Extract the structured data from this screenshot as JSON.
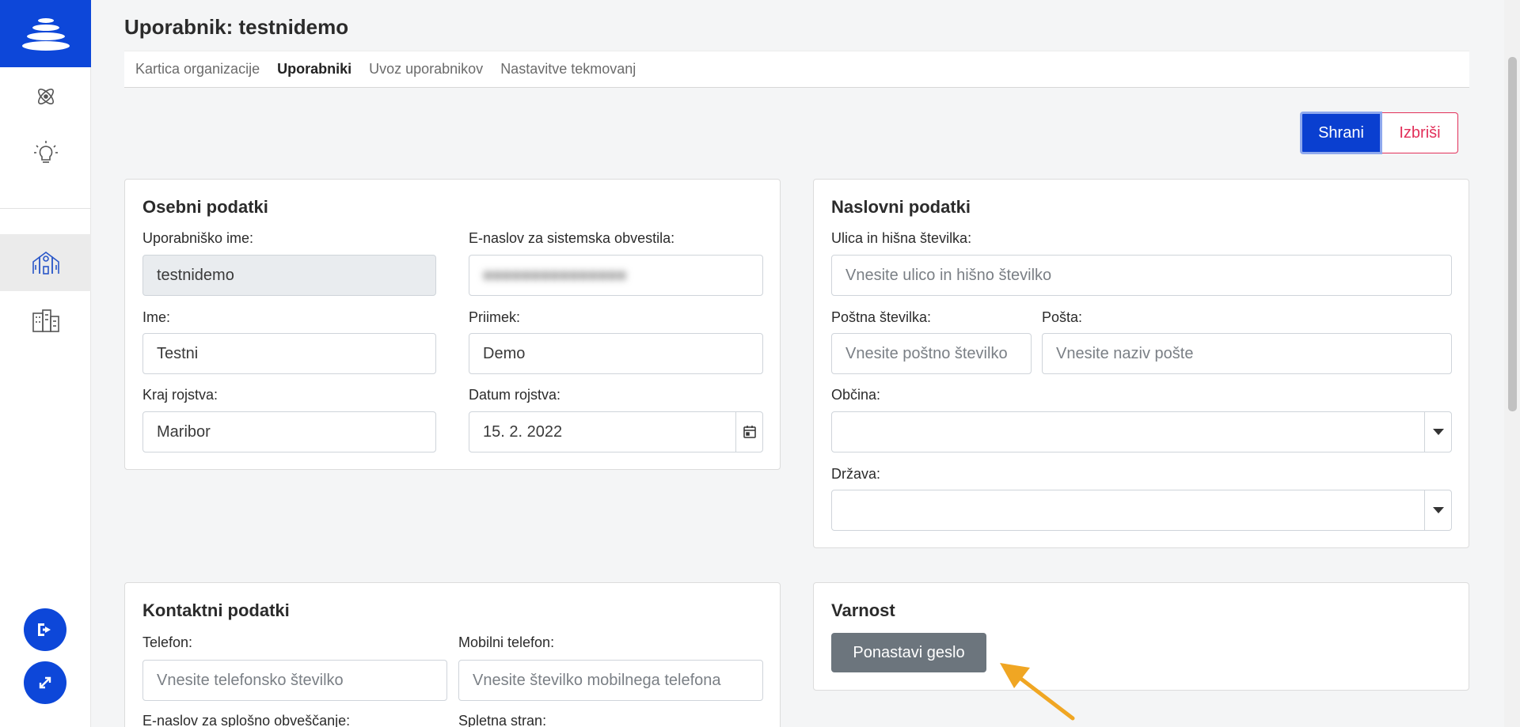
{
  "page_title": "Uporabnik: testnidemo",
  "subnav": [
    {
      "label": "Kartica organizacije",
      "active": false
    },
    {
      "label": "Uporabniki",
      "active": true
    },
    {
      "label": "Uvoz uporabnikov",
      "active": false
    },
    {
      "label": "Nastavitve tekmovanj",
      "active": false
    }
  ],
  "actions": {
    "save_label": "Shrani",
    "delete_label": "Izbriši"
  },
  "personal": {
    "title": "Osebni podatki",
    "username_label": "Uporabniško ime:",
    "username_value": "testnidemo",
    "email_label": "E-naslov za sistemska obvestila:",
    "firstname_label": "Ime:",
    "firstname_value": "Testni",
    "lastname_label": "Priimek:",
    "lastname_value": "Demo",
    "birthplace_label": "Kraj rojstva:",
    "birthplace_value": "Maribor",
    "birthdate_label": "Datum rojstva:",
    "birthdate_value": "15. 2. 2022"
  },
  "address": {
    "title": "Naslovni podatki",
    "street_label": "Ulica in hišna številka:",
    "street_placeholder": "Vnesite ulico in hišno številko",
    "postcode_label": "Poštna številka:",
    "postcode_placeholder": "Vnesite poštno številko",
    "post_label": "Pošta:",
    "post_placeholder": "Vnesite naziv pošte",
    "municipality_label": "Občina:",
    "country_label": "Država:"
  },
  "contact": {
    "title": "Kontaktni podatki",
    "phone_label": "Telefon:",
    "phone_placeholder": "Vnesite telefonsko številko",
    "mobile_label": "Mobilni telefon:",
    "mobile_placeholder": "Vnesite številko mobilnega telefona",
    "general_email_label": "E-naslov za splošno obveščanje:",
    "website_label": "Spletna stran:"
  },
  "security": {
    "title": "Varnost",
    "reset_password_label": "Ponastavi geslo"
  },
  "sidebar": {
    "icons": [
      "atom-icon",
      "lightbulb-icon",
      "school-icon",
      "buildings-icon"
    ],
    "bottom": [
      "logout-icon",
      "expand-icon"
    ]
  },
  "colors": {
    "primary": "#0d47d9",
    "danger": "#e2305a",
    "secondary": "#6c757d",
    "arrow": "#f0a623"
  }
}
